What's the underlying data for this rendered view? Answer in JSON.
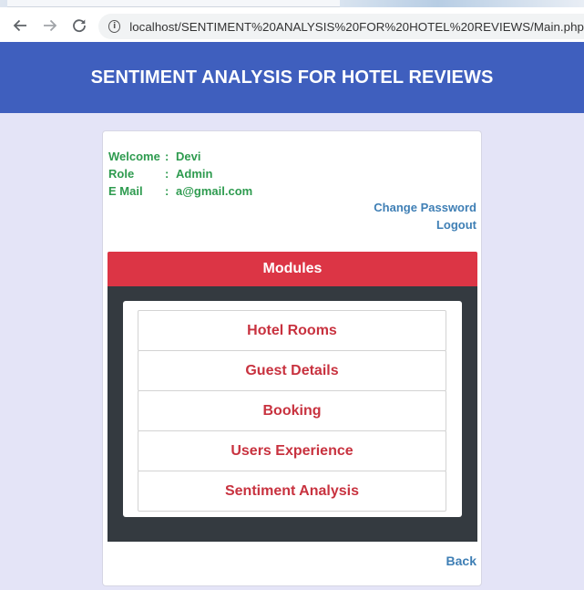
{
  "browser": {
    "url": "localhost/SENTIMENT%20ANALYSIS%20FOR%20HOTEL%20REVIEWS/Main.php",
    "back_icon": "arrow-left-icon",
    "forward_icon": "arrow-right-icon",
    "reload_icon": "reload-icon",
    "info_icon": "info-icon"
  },
  "header": {
    "title": "SENTIMENT ANALYSIS FOR HOTEL REVIEWS",
    "background": "#3f5fbe"
  },
  "user": {
    "welcome_label": "Welcome",
    "welcome_value": "Devi",
    "role_label": "Role",
    "role_value": "Admin",
    "email_label": "E Mail",
    "email_value": "a@gmail.com",
    "separator": ":"
  },
  "links": {
    "change_password": "Change Password",
    "logout": "Logout",
    "back": "Back"
  },
  "modules": {
    "title": "Modules",
    "items": [
      {
        "label": "Hotel Rooms"
      },
      {
        "label": "Guest Details"
      },
      {
        "label": "Booking"
      },
      {
        "label": "Users Experience"
      },
      {
        "label": "Sentiment Analysis"
      }
    ]
  },
  "colors": {
    "accent_red": "#dc3545",
    "dark_panel": "#343a40",
    "user_green": "#2e9b4f",
    "link_blue": "#3f7fb5"
  }
}
